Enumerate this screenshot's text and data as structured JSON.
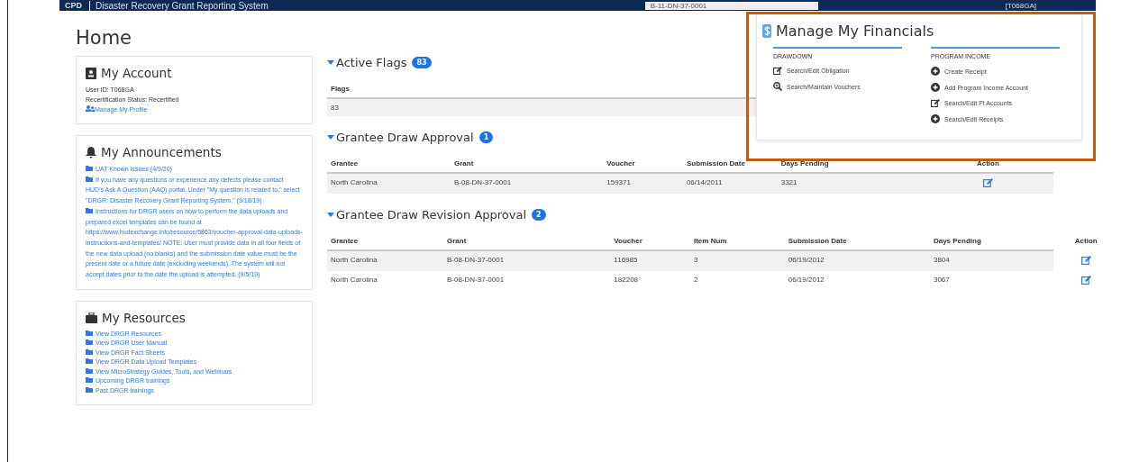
{
  "header": {
    "logo": "CPD",
    "title": "Disaster Recovery Grant Reporting System",
    "search_value": "B-11-DN-37-0001",
    "user": "[T068GA]"
  },
  "page_title": "Home",
  "account": {
    "title": "My Account",
    "lines": [
      "User ID: T068GA",
      "Recertification Status: Recertified"
    ],
    "link": "Manage My Profile"
  },
  "announcements": {
    "title": "My Announcements",
    "items": [
      "UAT Known Issues (4/9/20)",
      "If you have any questions or experience any defects please contact HUD's Ask A Question (AAQ) portal. Under \"My question is related to,\" select \"DRGR: Disaster Recovery Grant Reporting System.\" (9/18/19)",
      "Instructions for DRGR users on how to perform the data uploads and prepared excel templates can be found at https://www.hudexchange.info/resource/5863/voucher-approval-data-uploads-instructions-and-templates/ NOTE: User must provide data in all four fields of the new data upload (no blanks) and the submission date value must be the present date or a future date (excluding weekends). The system will not accept dates prior to the date the upload is attempted. (9/5/19)"
    ]
  },
  "resources": {
    "title": "My Resources",
    "items": [
      "View DRGR Resources",
      "View DRGR User Manual",
      "View DRGR Fact Sheets",
      "View DRGR Data Upload Templates",
      "View MicroStrategy Guides, Tools, and Webinars",
      "Upcoming DRGR trainings",
      "Past DRGR trainings"
    ]
  },
  "sections": [
    {
      "title": "Active Flags",
      "count": "83",
      "expanded": true,
      "columns": [
        "Flags"
      ],
      "rows": [
        {
          "cells": [
            "83"
          ],
          "action": false
        }
      ]
    },
    {
      "title": "Grantee Draw Approval",
      "count": "1",
      "expanded": true,
      "columns": [
        "Grantee",
        "Grant",
        "Voucher",
        "Submission Date",
        "Days Pending",
        "Action"
      ],
      "rows": [
        {
          "cells": [
            "North Carolina",
            "B-08-DN-37-0001",
            "159371",
            "06/14/2011",
            "3321"
          ],
          "action": true
        }
      ]
    },
    {
      "title": "Grantee Draw Revision Approval",
      "count": "2",
      "expanded": true,
      "columns": [
        "Grantee",
        "Grant",
        "Voucher",
        "Item Num",
        "Submission Date",
        "Days Pending",
        "Action"
      ],
      "rows": [
        {
          "cells": [
            "North Carolina",
            "B-08-DN-37-0001",
            "116985",
            "3",
            "06/19/2012",
            "3804"
          ],
          "action": true
        },
        {
          "cells": [
            "North Carolina",
            "B-08-DN-37-0001",
            "182208",
            "2",
            "06/19/2012",
            "3067"
          ],
          "action": true
        }
      ]
    }
  ],
  "financials": {
    "title": "Manage My Financials",
    "groups": [
      {
        "heading": "DRAWDOWN",
        "items": [
          {
            "kind": "edit",
            "label": "Search/Edit Obligation"
          },
          {
            "kind": "search",
            "label": "Search/Maintain Vouchers"
          }
        ]
      },
      {
        "heading": "PROGRAM INCOME",
        "items": [
          {
            "kind": "add",
            "label": "Create Receipt"
          },
          {
            "kind": "add",
            "label": "Add Program Income Account"
          },
          {
            "kind": "edit",
            "label": "Search/Edit PI Accounts"
          },
          {
            "kind": "add",
            "label": "Search/Edit Receipts"
          }
        ]
      }
    ]
  }
}
